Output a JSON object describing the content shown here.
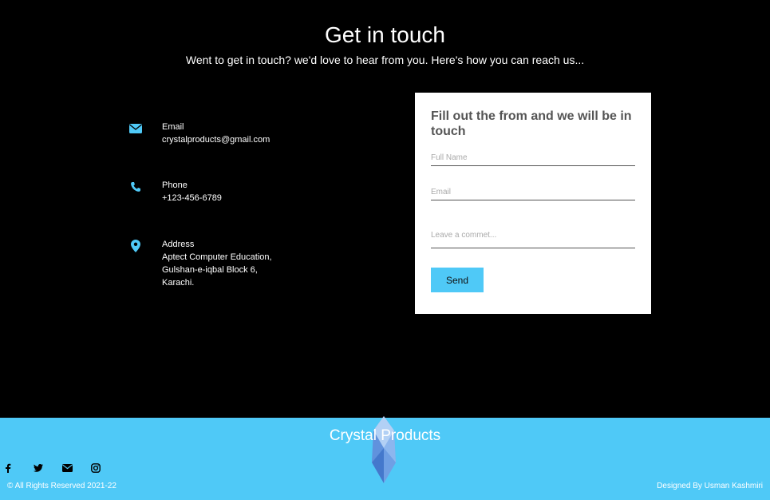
{
  "header": {
    "title": "Get in touch",
    "subtitle": "Went to get in touch? we'd love to hear from you. Here's how you can reach us..."
  },
  "contact": {
    "email": {
      "label": "Email",
      "value": "crystalproducts@gmail.com",
      "icon": "envelope-icon"
    },
    "phone": {
      "label": "Phone",
      "value": "+123-456-6789",
      "icon": "phone-icon"
    },
    "address": {
      "label": "Address",
      "value": "Aptect Computer Education,\nGulshan-e-iqbal Block 6,\nKarachi.",
      "icon": "map-pin-icon"
    }
  },
  "form": {
    "title": "Fill out the from and we will be in touch",
    "full_name_placeholder": "Full Name",
    "email_placeholder": "Email",
    "comment_placeholder": "Leave a commet...",
    "send_label": "Send"
  },
  "footer": {
    "brand": "Crystal Products",
    "copyright": "© All Rights Reserved 2021-22",
    "designer": "Designed By Usman Kashmiri",
    "socials": [
      "facebook-icon",
      "twitter-icon",
      "envelope-icon",
      "instagram-icon"
    ]
  },
  "colors": {
    "accent": "#4fc9f7",
    "background": "#000000",
    "card": "#ffffff"
  }
}
